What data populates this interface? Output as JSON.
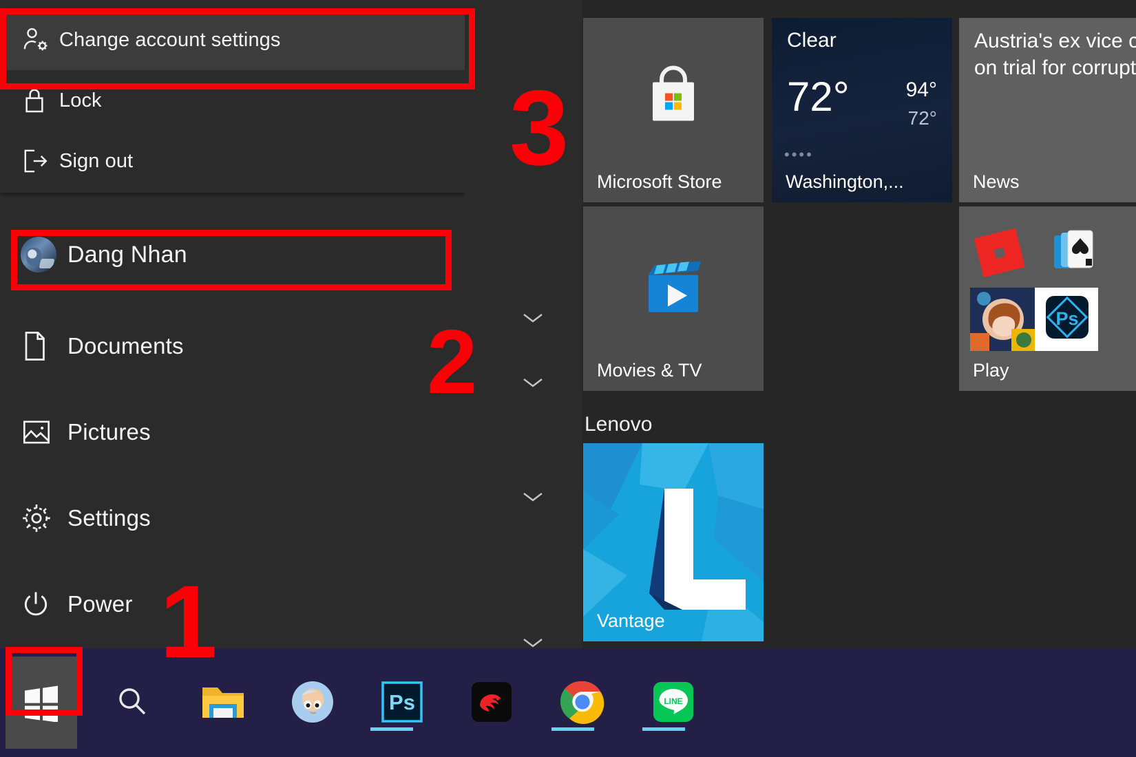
{
  "account_flyout": {
    "items": [
      {
        "label": "Change account settings",
        "icon": "account-settings-icon",
        "selected": true
      },
      {
        "label": "Lock",
        "icon": "lock-icon",
        "selected": false
      },
      {
        "label": "Sign out",
        "icon": "sign-out-icon",
        "selected": false
      }
    ]
  },
  "places": [
    {
      "label": "Dang Nhan",
      "icon": "user-avatar-icon",
      "type": "user"
    },
    {
      "label": "Documents",
      "icon": "document-icon",
      "type": "place"
    },
    {
      "label": "Pictures",
      "icon": "picture-icon",
      "type": "place"
    },
    {
      "label": "Settings",
      "icon": "gear-icon",
      "type": "place"
    },
    {
      "label": "Power",
      "icon": "power-icon",
      "type": "place"
    }
  ],
  "tiles": {
    "store": {
      "label": "Microsoft Store",
      "icon": "microsoft-store-icon"
    },
    "movies": {
      "label": "Movies & TV",
      "icon": "movies-tv-icon"
    },
    "weather": {
      "condition": "Clear",
      "temperature": "72°",
      "high": "94°",
      "low": "72°",
      "label": "Washington,...",
      "dots": "••••"
    },
    "news": {
      "headline": "Austria's ex vice chance on trial for corruption...",
      "label": "News"
    },
    "play": {
      "label": "Play",
      "icons": [
        "roblox-icon",
        "solitaire-icon",
        "game-art-icon",
        "photoshop-express-icon"
      ]
    },
    "vantage": {
      "label": "Vantage",
      "icon": "lenovo-vantage-icon"
    }
  },
  "groups": [
    {
      "label": "Lenovo"
    }
  ],
  "taskbar": {
    "start_label": "Start",
    "items": [
      {
        "name": "search-icon",
        "running": false
      },
      {
        "name": "file-explorer-icon",
        "running": true
      },
      {
        "name": "gimp-icon",
        "running": false
      },
      {
        "name": "photoshop-icon",
        "running": true
      },
      {
        "name": "garena-icon",
        "running": false
      },
      {
        "name": "chrome-icon",
        "running": true
      },
      {
        "name": "line-icon",
        "running": true
      }
    ]
  },
  "annotations": {
    "step1": "1",
    "step2": "2",
    "step3": "3",
    "accent_color": "#fb0007"
  }
}
